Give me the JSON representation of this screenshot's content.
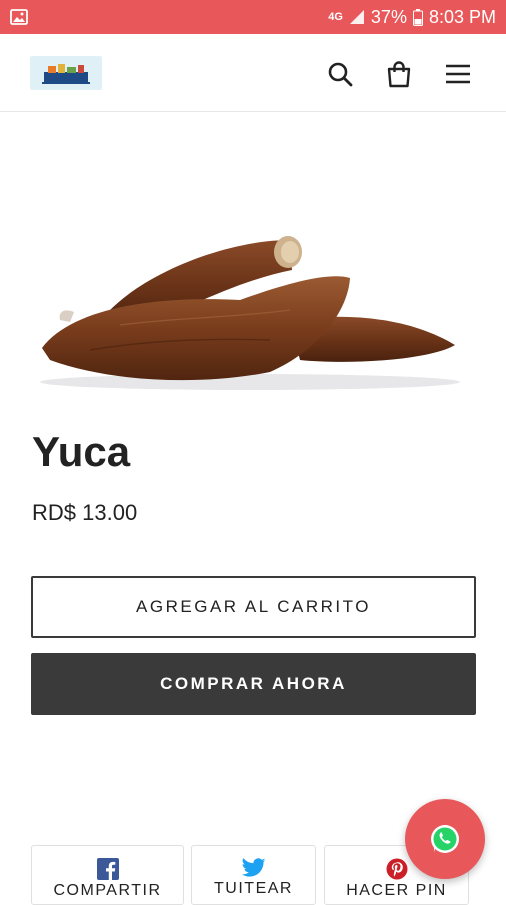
{
  "status_bar": {
    "network": "4G",
    "battery": "37%",
    "time": "8:03 PM"
  },
  "header": {
    "logo_alt": "store-logo",
    "icons": [
      "search-icon",
      "cart-icon",
      "menu-icon"
    ]
  },
  "product": {
    "title": "Yuca",
    "price": "RD$ 13.00",
    "add_to_cart_label": "AGREGAR AL CARRITO",
    "buy_now_label": "COMPRAR AHORA"
  },
  "share": {
    "facebook_label": "COMPARTIR",
    "twitter_label": "TUITEAR",
    "pinterest_label": "HACER PIN"
  },
  "colors": {
    "brand_accent": "#e8585a",
    "button_dark": "#3a3a3a",
    "facebook": "#3b5998",
    "twitter": "#1da1f2",
    "pinterest": "#cb2027",
    "whatsapp": "#25d366"
  }
}
